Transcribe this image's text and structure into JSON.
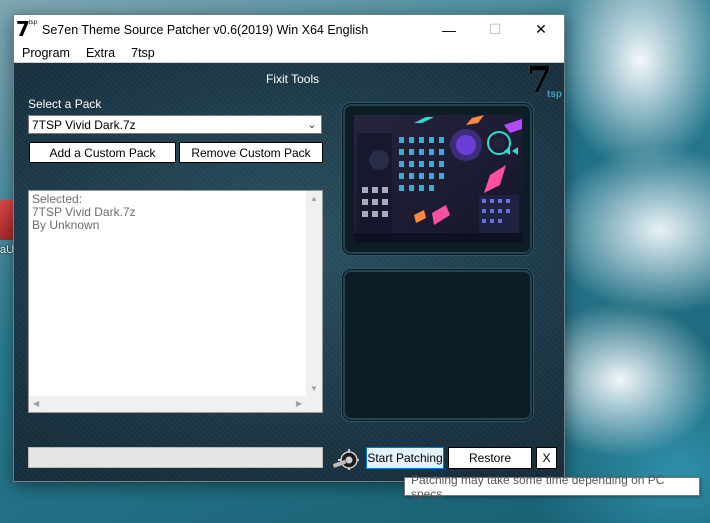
{
  "window": {
    "title": "Se7en Theme Source Patcher v0.6(2019) Win X64 English",
    "app_logo": {
      "seven": "7",
      "tsp": "tsp"
    },
    "controls": {
      "minimize": "—",
      "maximize": "☐",
      "close": "✕"
    }
  },
  "menu": [
    "Program",
    "Extra",
    "7tsp"
  ],
  "header": {
    "title": "Fixit Tools",
    "brand_logo": {
      "seven": "7",
      "tsp": "tsp"
    }
  },
  "pack": {
    "label": "Select a Pack",
    "selected": "7TSP Vivid Dark.7z",
    "add_label": "Add a Custom Pack",
    "remove_label": "Remove Custom Pack"
  },
  "info": {
    "line1": "Selected:",
    "line2": "7TSP Vivid Dark.7z",
    "line3": "By Unknown"
  },
  "actions": {
    "start_label": "Start Patching",
    "restore_label": "Restore",
    "close_label": "X"
  },
  "tooltip": "Patching may take some time depending on PC specs",
  "desktop": {
    "icon_label": "aU"
  },
  "colors": {
    "client_bg": "#1f3d4c",
    "accent_focus": "#0078d7",
    "preview_frame": "#244452"
  },
  "icons": [
    "minimize-icon",
    "maximize-icon",
    "close-icon",
    "chevron-down-icon",
    "scroll-up-icon",
    "scroll-down-icon",
    "scroll-left-icon",
    "scroll-right-icon",
    "gear-wrench-icon"
  ]
}
